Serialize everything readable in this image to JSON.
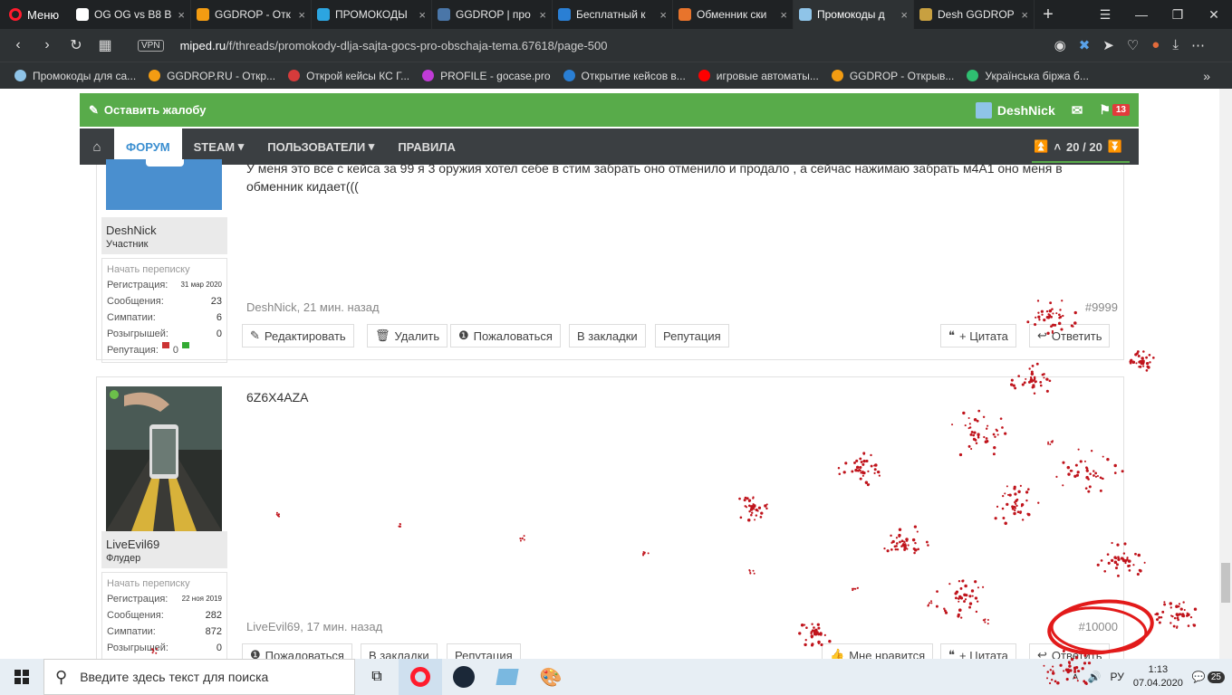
{
  "browser": {
    "menu_label": "Меню",
    "tabs": [
      {
        "title": "OG OG vs B8 B",
        "color": "#ffffff"
      },
      {
        "title": "GGDROP - Отк",
        "color": "#f39c12"
      },
      {
        "title": "ПРОМОКОДЫ",
        "color": "#2ca5e0"
      },
      {
        "title": "GGDROP | про",
        "color": "#4a76a8"
      },
      {
        "title": "Бесплатный к",
        "color": "#2a7fd4"
      },
      {
        "title": "Обменник ски",
        "color": "#e8742c"
      },
      {
        "title": "Промокоды д",
        "color": "#8fc4e8",
        "active": true
      },
      {
        "title": "Desh GGDROP",
        "color": "#c8a040"
      }
    ],
    "new_tab": "+",
    "vpn_label": "VPN",
    "url_host": "miped.ru",
    "url_path": "/f/threads/promokody-dlja-sajta-gocs-pro-obschaja-tema.67618/page-500",
    "bookmarks": [
      {
        "label": "Промокоды для са...",
        "color": "#8fc4e8"
      },
      {
        "label": "GGDROP.RU - Откр...",
        "color": "#f39c12"
      },
      {
        "label": "Открой кейсы КС Г...",
        "color": "#d63b3b"
      },
      {
        "label": "PROFILE - gocase.pro",
        "color": "#c03bd6"
      },
      {
        "label": "Открытие кейсов в...",
        "color": "#2a7fd4"
      },
      {
        "label": "игровые автоматы...",
        "color": "#ff0000"
      },
      {
        "label": "GGDROP - Открыв...",
        "color": "#f39c12"
      },
      {
        "label": "Українська біржа б...",
        "color": "#2fbf71"
      }
    ],
    "bookmarks_more": "»"
  },
  "site": {
    "complain": "Оставить жалобу",
    "username": "DeshNick",
    "alerts_count": "13",
    "nav": [
      "ФОРУМ",
      "STEAM",
      "ПОЛЬЗОВАТЕЛИ",
      "ПРАВИЛА"
    ],
    "pager": "20 / 20",
    "accent": "#58ab4a",
    "link": "#3a8ed0"
  },
  "posts": [
    {
      "author": "DeshNick",
      "title": "Участник",
      "pm": "Начать переписку",
      "stats": [
        {
          "k": "Регистрация:",
          "v": "31 мар 2020"
        },
        {
          "k": "Сообщения:",
          "v": "23"
        },
        {
          "k": "Симпатии:",
          "v": "6"
        },
        {
          "k": "Розыгрышей:",
          "v": "0"
        }
      ],
      "rep_label": "Репутация:",
      "rep_value": "0",
      "text": "У меня это все с кейса за 99 я 3 оружия хотел себе в стим забрать оно отменило и продало , а сейчас нажимаю забрать м4А1 оно меня в обменник кидает(((",
      "meta": "DeshNick, 21 мин. назад",
      "num": "#9999",
      "actions": [
        "Редактировать",
        "Удалить",
        "Пожаловаться",
        "В закладки",
        "Репутация"
      ],
      "right_actions": [
        "+ Цитата",
        "Ответить"
      ]
    },
    {
      "author": "LiveEvil69",
      "title": "Флудер",
      "pm": "Начать переписку",
      "stats": [
        {
          "k": "Регистрация:",
          "v": "22 ноя 2019"
        },
        {
          "k": "Сообщения:",
          "v": "282"
        },
        {
          "k": "Симпатии:",
          "v": "872"
        },
        {
          "k": "Розыгрышей:",
          "v": "0"
        }
      ],
      "text": "6Z6X4AZA",
      "meta": "LiveEvil69, 17 мин. назад",
      "num": "#10000",
      "actions": [
        "Пожаловаться",
        "В закладки",
        "Репутация"
      ],
      "right_actions": [
        "Мне нравится",
        "+ Цитата",
        "Ответить"
      ]
    }
  ],
  "taskbar": {
    "search_placeholder": "Введите здесь текст для поиска",
    "lang": "РУ",
    "time": "1:13",
    "date": "07.04.2020",
    "notif": "25"
  }
}
